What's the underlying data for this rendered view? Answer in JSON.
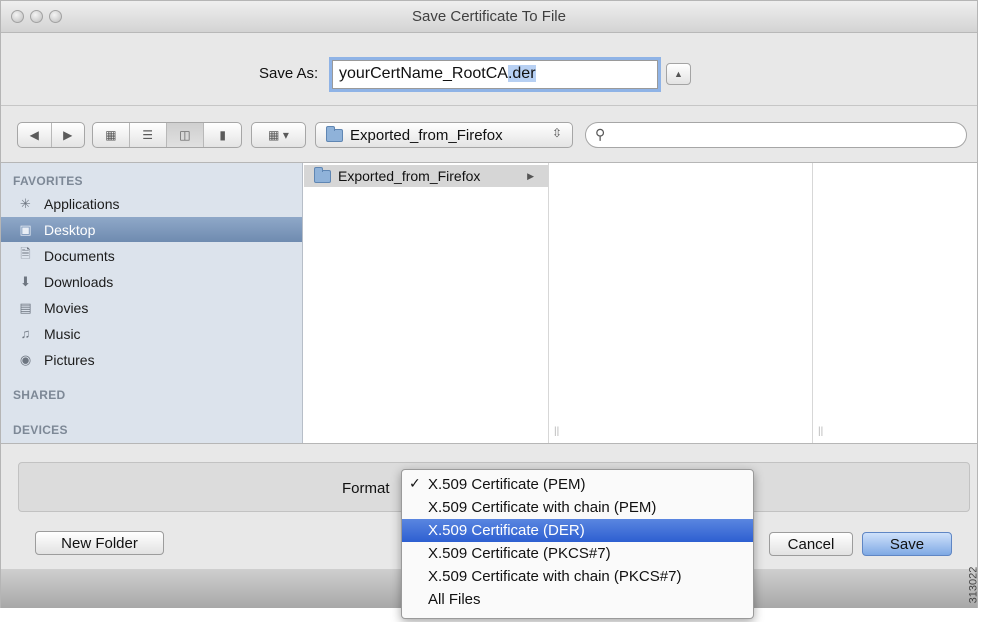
{
  "window": {
    "title": "Save Certificate To File"
  },
  "save_as": {
    "label": "Save As:",
    "filename_base": "yourCertName_RootCA",
    "filename_ext": ".der"
  },
  "toolbar": {
    "location": "Exported_from_Firefox"
  },
  "sidebar": {
    "favorites_heading": "FAVORITES",
    "items": [
      {
        "label": "Applications",
        "icon": "applications-icon"
      },
      {
        "label": "Desktop",
        "icon": "desktop-icon",
        "selected": true
      },
      {
        "label": "Documents",
        "icon": "documents-icon"
      },
      {
        "label": "Downloads",
        "icon": "downloads-icon"
      },
      {
        "label": "Movies",
        "icon": "movies-icon"
      },
      {
        "label": "Music",
        "icon": "music-icon"
      },
      {
        "label": "Pictures",
        "icon": "pictures-icon"
      }
    ],
    "shared_heading": "SHARED",
    "devices_heading": "DEVICES"
  },
  "browser": {
    "column1_item": "Exported_from_Firefox"
  },
  "format": {
    "label": "Format",
    "options": [
      {
        "label": "X.509 Certificate (PEM)",
        "checked": true
      },
      {
        "label": "X.509 Certificate with chain (PEM)"
      },
      {
        "label": "X.509 Certificate (DER)",
        "highlighted": true
      },
      {
        "label": "X.509 Certificate (PKCS#7)"
      },
      {
        "label": "X.509 Certificate with chain (PKCS#7)"
      },
      {
        "label": "All Files"
      }
    ]
  },
  "buttons": {
    "new_folder": "New Folder",
    "cancel": "Cancel",
    "save": "Save"
  },
  "figure_code": "313022",
  "colors": {
    "selection": "#6f8bb0",
    "menu_highlight": "#2d5fd1",
    "focus_ring": "#8fb3e6"
  }
}
